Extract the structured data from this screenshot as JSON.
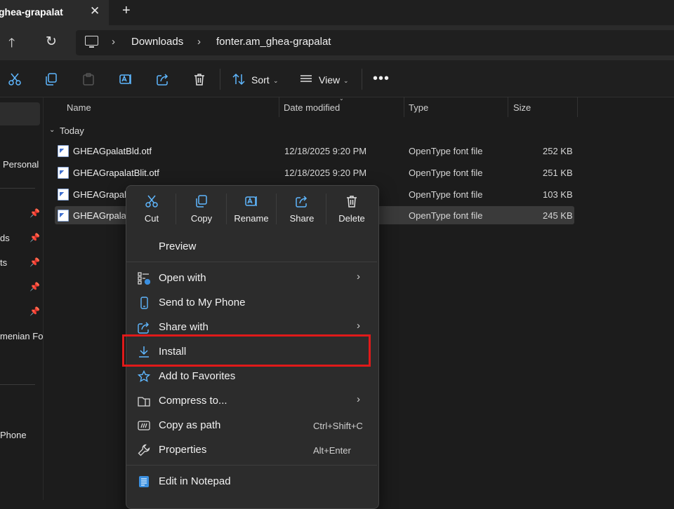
{
  "window": {
    "tab_title": "ghea-grapalat",
    "close_glyph": "✕",
    "new_tab_glyph": "+"
  },
  "address": {
    "crumbs": [
      "Downloads",
      "fonter.am_ghea-grapalat"
    ]
  },
  "toolbar": {
    "sort_label": "Sort",
    "view_label": "View",
    "more_glyph": "•••"
  },
  "sidebar": {
    "items": [
      "Personal",
      "ds",
      "ts",
      "menian Fo",
      "Phone"
    ]
  },
  "columns": {
    "name": "Name",
    "date": "Date modified",
    "type": "Type",
    "size": "Size"
  },
  "group": "Today",
  "files": [
    {
      "name": "GHEAGpalatBld.otf",
      "date": "12/18/2025 9:20 PM",
      "type": "OpenType font file",
      "size": "252 KB"
    },
    {
      "name": "GHEAGrapalatBlit.otf",
      "date": "12/18/2025 9:20 PM",
      "type": "OpenType font file",
      "size": "251 KB"
    },
    {
      "name": "GHEAGrapala",
      "date": "",
      "type": "OpenType font file",
      "size": "103 KB"
    },
    {
      "name": "GHEAGrpalat",
      "date": "",
      "type": "OpenType font file",
      "size": "245 KB"
    }
  ],
  "context_menu": {
    "quick_actions": [
      "Cut",
      "Copy",
      "Rename",
      "Share",
      "Delete"
    ],
    "items": [
      {
        "label": "Preview"
      },
      {
        "label": "Open with"
      },
      {
        "label": "Send to My Phone"
      },
      {
        "label": "Share with"
      },
      {
        "label": "Install"
      },
      {
        "label": "Add to Favorites"
      },
      {
        "label": "Compress to..."
      },
      {
        "label": "Copy as path",
        "shortcut": "Ctrl+Shift+C"
      },
      {
        "label": "Properties",
        "shortcut": "Alt+Enter"
      },
      {
        "label": "Edit in Notepad"
      }
    ]
  },
  "colors": {
    "accent": "#4cc2ff",
    "highlight": "#e01a1a",
    "menu_bg": "#2c2c2c"
  }
}
